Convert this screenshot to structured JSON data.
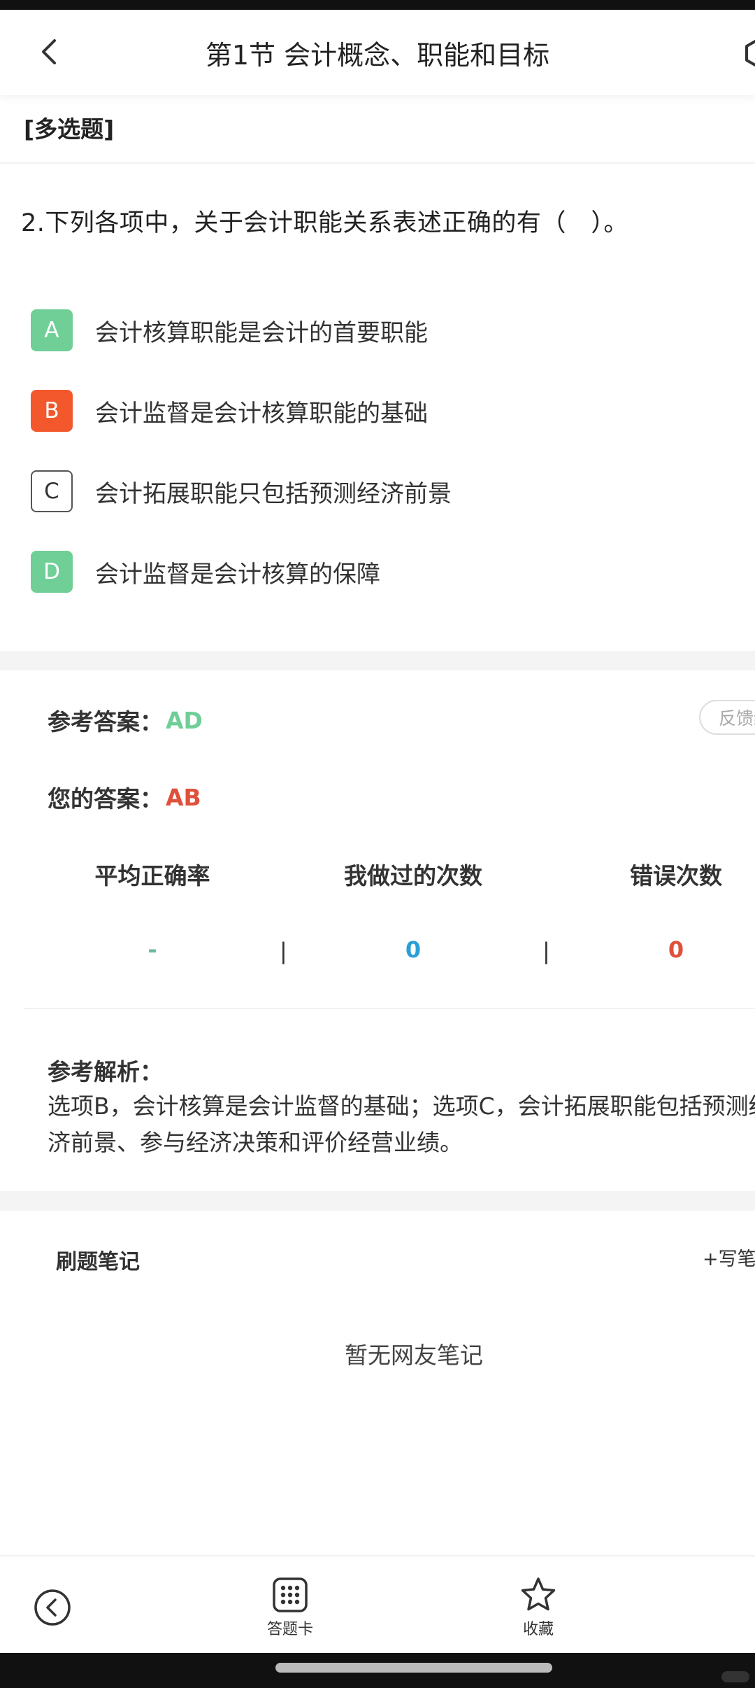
{
  "header": {
    "title": "第1节 会计概念、职能和目标"
  },
  "question": {
    "type_label": "[多选题]",
    "text": "2.下列各项中，关于会计职能关系表述正确的有（　）。",
    "options": [
      {
        "letter": "A",
        "text": "会计核算职能是会计的首要职能",
        "state": "correct"
      },
      {
        "letter": "B",
        "text": "会计监督是会计核算职能的基础",
        "state": "wrong"
      },
      {
        "letter": "C",
        "text": "会计拓展职能只包括预测经济前景",
        "state": "unselected"
      },
      {
        "letter": "D",
        "text": "会计监督是会计核算的保障",
        "state": "correct"
      }
    ]
  },
  "answers": {
    "reference_label": "参考答案：",
    "reference_value": "AD",
    "mine_label": "您的答案：",
    "mine_value": "AB",
    "feedback_label": "反馈纠错"
  },
  "stats": {
    "avg_rate_label": "平均正确率",
    "avg_rate_value": "-",
    "done_count_label": "我做过的次数",
    "done_count_value": "0",
    "error_count_label": "错误次数",
    "error_count_value": "0",
    "separator": "|"
  },
  "analysis": {
    "title": "参考解析：",
    "text": "选项B，会计核算是会计监督的基础；选项C，会计拓展职能包括预测经济前景、参与经济决策和评价经营业绩。"
  },
  "notes": {
    "title": "刷题笔记",
    "write_label": "+写笔记",
    "empty_text": "暂无网友笔记"
  },
  "bottom_bar": {
    "answer_card_label": "答题卡",
    "favorite_label": "收藏"
  },
  "colors": {
    "correct": "#6fcf97",
    "wrong": "#f2582b",
    "count_blue": "#2a9fd6",
    "count_red": "#e0503a",
    "avg_dash": "#6fb8a0"
  }
}
